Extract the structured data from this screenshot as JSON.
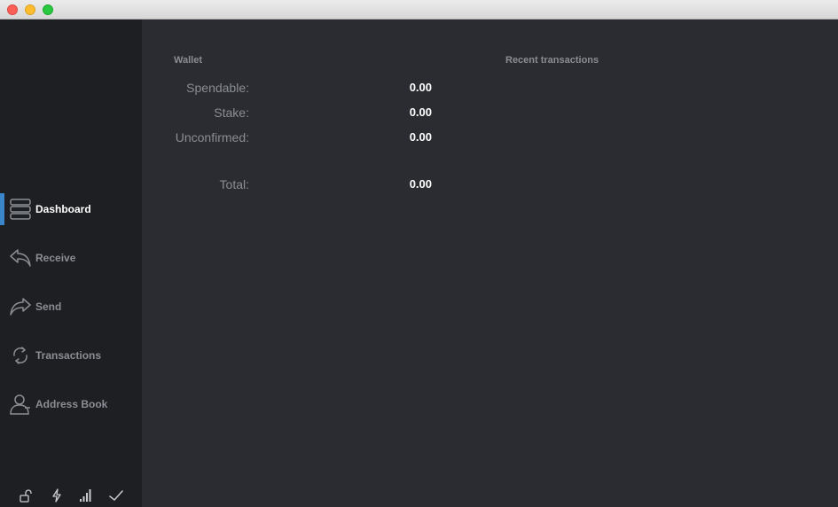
{
  "sidebar": {
    "items": [
      {
        "label": "Dashboard",
        "icon": "dashboard-icon",
        "active": true
      },
      {
        "label": "Receive",
        "icon": "receive-icon",
        "active": false
      },
      {
        "label": "Send",
        "icon": "send-icon",
        "active": false
      },
      {
        "label": "Transactions",
        "icon": "transactions-icon",
        "active": false
      },
      {
        "label": "Address Book",
        "icon": "address-book-icon",
        "active": false
      }
    ],
    "status_icons": [
      "unlock-icon",
      "lightning-icon",
      "signal-icon",
      "checkmark-icon"
    ]
  },
  "wallet": {
    "title": "Wallet",
    "spendable_label": "Spendable:",
    "spendable_value": "0.00",
    "stake_label": "Stake:",
    "stake_value": "0.00",
    "unconfirmed_label": "Unconfirmed:",
    "unconfirmed_value": "0.00",
    "total_label": "Total:",
    "total_value": "0.00"
  },
  "recent": {
    "title": "Recent transactions"
  },
  "colors": {
    "accent": "#3a86c8",
    "sidebar_bg": "#1e1f23",
    "main_bg": "#2a2c31",
    "muted_text": "#8a8d93"
  }
}
